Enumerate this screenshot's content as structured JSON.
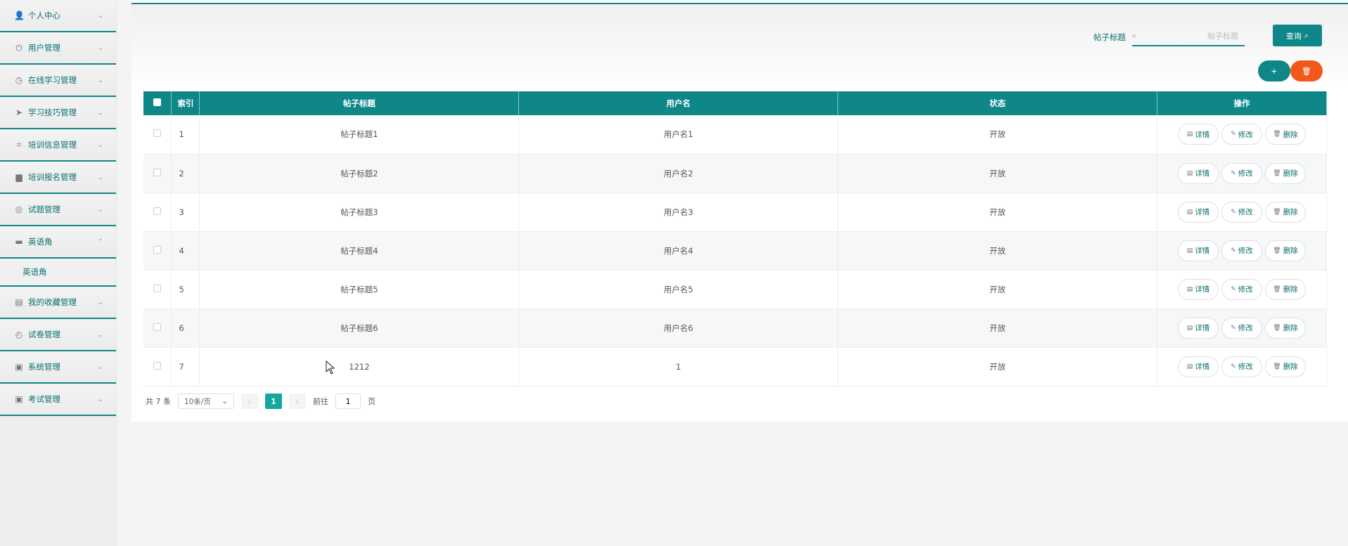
{
  "sidebar": {
    "items": [
      {
        "label": "个人中心",
        "icon": "user-icon",
        "glyph": "👤",
        "caret": "⌄"
      },
      {
        "label": "用户管理",
        "icon": "power-icon",
        "glyph": "⏻",
        "caret": "⌄"
      },
      {
        "label": "在线学习管理",
        "icon": "gauge-icon",
        "glyph": "◷",
        "caret": "⌄"
      },
      {
        "label": "学习技巧管理",
        "icon": "send-icon",
        "glyph": "➤",
        "caret": "⌄"
      },
      {
        "label": "培训信息管理",
        "icon": "crop-icon",
        "glyph": "⌗",
        "caret": "⌄"
      },
      {
        "label": "培训报名管理",
        "icon": "comment-icon",
        "glyph": "▆",
        "caret": "⌄"
      },
      {
        "label": "试题管理",
        "icon": "target-icon",
        "glyph": "◎",
        "caret": "⌄"
      },
      {
        "label": "英语角",
        "icon": "briefcase-icon",
        "glyph": "▬",
        "caret": "⌃",
        "sub": "英语角"
      },
      {
        "label": "我的收藏管理",
        "icon": "printer-icon",
        "glyph": "▤",
        "caret": "⌄"
      },
      {
        "label": "试卷管理",
        "icon": "clock-icon",
        "glyph": "◴",
        "caret": "⌄"
      },
      {
        "label": "系统管理",
        "icon": "clipboard-icon",
        "glyph": "▣",
        "caret": "⌄"
      },
      {
        "label": "考试管理",
        "icon": "clipboard-check-icon",
        "glyph": "▣",
        "caret": "⌄"
      }
    ]
  },
  "search": {
    "label": "帖子标题",
    "placeholder": "帖子标题",
    "button": "查询"
  },
  "actions": {
    "add": "+",
    "delete": "🗑"
  },
  "table": {
    "headers": [
      "",
      "索引",
      "帖子标题",
      "用户名",
      "状态",
      "操作"
    ],
    "rows": [
      {
        "idx": "1",
        "title": "帖子标题1",
        "user": "用户名1",
        "status": "开放"
      },
      {
        "idx": "2",
        "title": "帖子标题2",
        "user": "用户名2",
        "status": "开放"
      },
      {
        "idx": "3",
        "title": "帖子标题3",
        "user": "用户名3",
        "status": "开放"
      },
      {
        "idx": "4",
        "title": "帖子标题4",
        "user": "用户名4",
        "status": "开放"
      },
      {
        "idx": "5",
        "title": "帖子标题5",
        "user": "用户名5",
        "status": "开放"
      },
      {
        "idx": "6",
        "title": "帖子标题6",
        "user": "用户名6",
        "status": "开放"
      },
      {
        "idx": "7",
        "title": "1212",
        "user": "1",
        "status": "开放"
      }
    ],
    "ops": {
      "detail": "详情",
      "edit": "修改",
      "delete": "删除"
    }
  },
  "pager": {
    "total": "共 7 条",
    "page_size": "10条/页",
    "current": "1",
    "goto_prefix": "前往",
    "goto_value": "1",
    "goto_suffix": "页"
  },
  "colors": {
    "accent": "#0f8789",
    "danger": "#f2581c"
  }
}
